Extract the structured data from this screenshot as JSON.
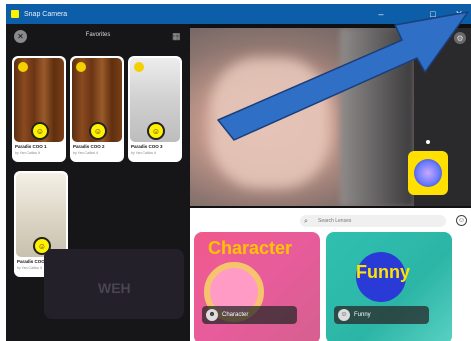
{
  "window": {
    "title": "Snap Camera",
    "minimize_glyph": "–",
    "maximize_glyph": "□",
    "close_glyph": "✕"
  },
  "favorites": {
    "title": "Favorites",
    "close_glyph": "✕",
    "items": [
      {
        "name": "Paradis COO 1",
        "sub": "by Yan Cailiou it"
      },
      {
        "name": "Paradis COO 2",
        "sub": "by Yan Cailiou it"
      },
      {
        "name": "Paradis COO 3",
        "sub": "by Yan Cailiou it"
      },
      {
        "name": "Paradis COO 4",
        "sub": "by Yan Cailiou it"
      }
    ],
    "background_text": "WEH"
  },
  "browser": {
    "search_placeholder": "Search Lenses",
    "categories": [
      {
        "title": "Character",
        "label": "Character"
      },
      {
        "title": "Funny",
        "label": "Funny"
      }
    ]
  },
  "colors": {
    "titlebar": "#0d5ea8",
    "arrow": "#2f6fc6",
    "snap_yellow": "#fff100"
  }
}
